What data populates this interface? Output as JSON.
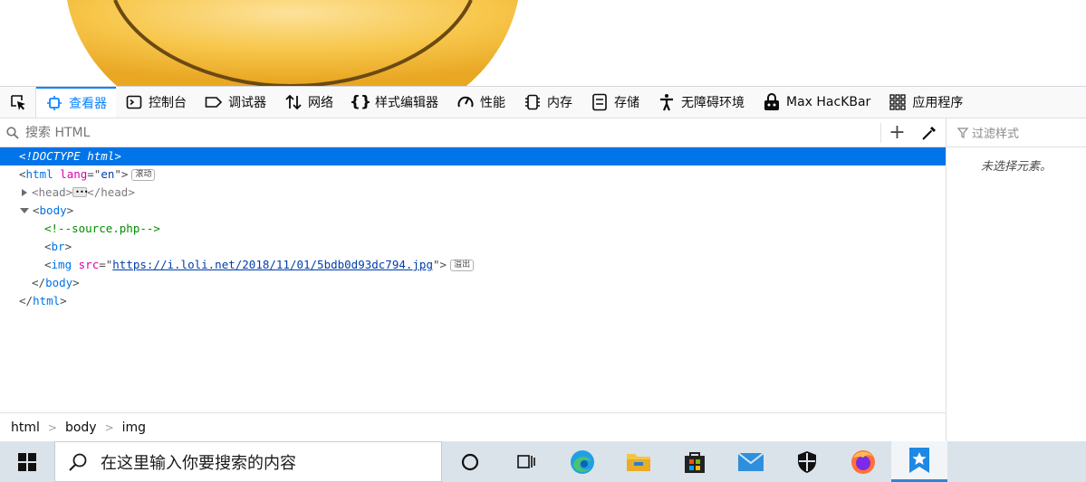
{
  "toolbar": {
    "tabs": [
      {
        "label": "查看器",
        "icon": "inspector-icon",
        "active": true
      },
      {
        "label": "控制台",
        "icon": "console-icon"
      },
      {
        "label": "调试器",
        "icon": "debugger-icon"
      },
      {
        "label": "网络",
        "icon": "network-icon"
      },
      {
        "label": "样式编辑器",
        "icon": "style-editor-icon"
      },
      {
        "label": "性能",
        "icon": "performance-icon"
      },
      {
        "label": "内存",
        "icon": "memory-icon"
      },
      {
        "label": "存储",
        "icon": "storage-icon"
      },
      {
        "label": "无障碍环境",
        "icon": "accessibility-icon"
      },
      {
        "label": "Max HacKBar",
        "icon": "hackbar-icon"
      },
      {
        "label": "应用程序",
        "icon": "application-icon"
      }
    ]
  },
  "search": {
    "placeholder": "搜索 HTML",
    "add_label": "+"
  },
  "markup": {
    "doctype": "<!DOCTYPE html>",
    "html_open_tag": "html",
    "lang_attr": "lang",
    "lang_value": "en",
    "scroll_badge": "滚动",
    "head_tag": "head",
    "body_tag": "body",
    "comment": "<!--source.php-->",
    "br_tag": "br",
    "img_tag": "img",
    "src_attr": "src",
    "img_src": "https://i.loli.net/2018/11/01/5bdb0d93dc794.jpg",
    "overflow_badge": "溢出"
  },
  "breadcrumb": [
    "html",
    "body",
    "img"
  ],
  "rules": {
    "filter_placeholder": "过滤样式",
    "empty_message": "未选择元素。"
  },
  "taskbar": {
    "search_placeholder": "在这里输入你要搜索的内容"
  },
  "colors": {
    "accent": "#0a84ff",
    "selection": "#0074e8",
    "tag": "#dd00a9",
    "comment": "#058b00"
  }
}
